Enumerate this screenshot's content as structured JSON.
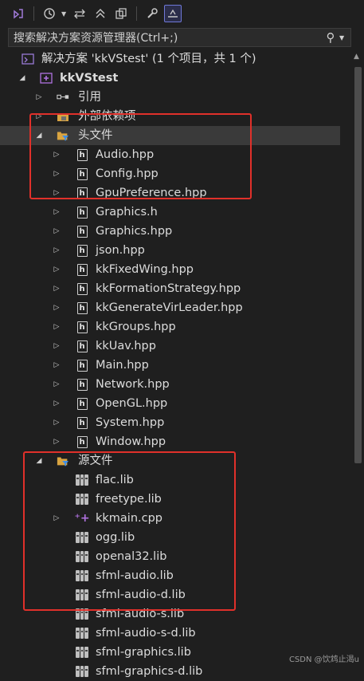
{
  "search": {
    "placeholder": "搜索解决方案资源管理器(Ctrl+;)"
  },
  "toolbar": {
    "icons": [
      "vs-icon",
      "history-icon",
      "sync-icon",
      "collapse-icon",
      "copy-icon",
      "wrench-icon",
      "preview-icon"
    ]
  },
  "solution": {
    "label": "解决方案 'kkVStest' (1 个项目，共 1 个)"
  },
  "project": {
    "label": "kkVStest"
  },
  "references": {
    "label": "引用"
  },
  "external": {
    "label": "外部依赖项"
  },
  "header_folder": {
    "label": "头文件",
    "files": [
      "Audio.hpp",
      "Config.hpp",
      "GpuPreference.hpp",
      "Graphics.h",
      "Graphics.hpp",
      "json.hpp",
      "kkFixedWing.hpp",
      "kkFormationStrategy.hpp",
      "kkGenerateVirLeader.hpp",
      "kkGroups.hpp",
      "kkUav.hpp",
      "Main.hpp",
      "Network.hpp",
      "OpenGL.hpp",
      "System.hpp",
      "Window.hpp"
    ]
  },
  "source_folder": {
    "label": "源文件",
    "files": [
      {
        "name": "flac.lib",
        "type": "lib"
      },
      {
        "name": "freetype.lib",
        "type": "lib"
      },
      {
        "name": "kkmain.cpp",
        "type": "cpp"
      },
      {
        "name": "ogg.lib",
        "type": "lib"
      },
      {
        "name": "openal32.lib",
        "type": "lib"
      },
      {
        "name": "sfml-audio.lib",
        "type": "lib"
      },
      {
        "name": "sfml-audio-d.lib",
        "type": "lib"
      },
      {
        "name": "sfml-audio-s.lib",
        "type": "lib"
      },
      {
        "name": "sfml-audio-s-d.lib",
        "type": "lib"
      },
      {
        "name": "sfml-graphics.lib",
        "type": "lib"
      },
      {
        "name": "sfml-graphics-d.lib",
        "type": "lib"
      }
    ]
  },
  "watermark": "CSDN @饮鸩止渴u",
  "colors": {
    "highlight_box": "#e0302a",
    "folder": "#d9a441",
    "filter_badge": "#3f8ee6",
    "project_icon": "#b072e0"
  }
}
